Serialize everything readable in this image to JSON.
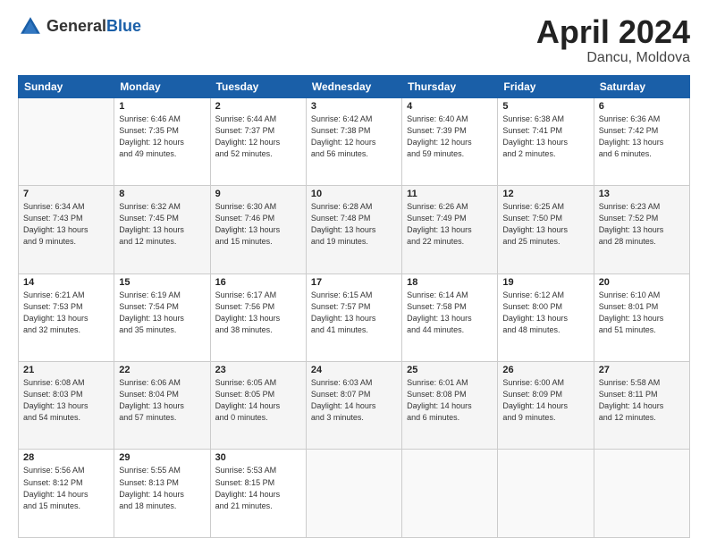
{
  "header": {
    "logo_line1": "General",
    "logo_line2": "Blue",
    "month_title": "April 2024",
    "location": "Dancu, Moldova"
  },
  "days_of_week": [
    "Sunday",
    "Monday",
    "Tuesday",
    "Wednesday",
    "Thursday",
    "Friday",
    "Saturday"
  ],
  "weeks": [
    [
      {
        "day": "",
        "info": ""
      },
      {
        "day": "1",
        "info": "Sunrise: 6:46 AM\nSunset: 7:35 PM\nDaylight: 12 hours\nand 49 minutes."
      },
      {
        "day": "2",
        "info": "Sunrise: 6:44 AM\nSunset: 7:37 PM\nDaylight: 12 hours\nand 52 minutes."
      },
      {
        "day": "3",
        "info": "Sunrise: 6:42 AM\nSunset: 7:38 PM\nDaylight: 12 hours\nand 56 minutes."
      },
      {
        "day": "4",
        "info": "Sunrise: 6:40 AM\nSunset: 7:39 PM\nDaylight: 12 hours\nand 59 minutes."
      },
      {
        "day": "5",
        "info": "Sunrise: 6:38 AM\nSunset: 7:41 PM\nDaylight: 13 hours\nand 2 minutes."
      },
      {
        "day": "6",
        "info": "Sunrise: 6:36 AM\nSunset: 7:42 PM\nDaylight: 13 hours\nand 6 minutes."
      }
    ],
    [
      {
        "day": "7",
        "info": "Sunrise: 6:34 AM\nSunset: 7:43 PM\nDaylight: 13 hours\nand 9 minutes."
      },
      {
        "day": "8",
        "info": "Sunrise: 6:32 AM\nSunset: 7:45 PM\nDaylight: 13 hours\nand 12 minutes."
      },
      {
        "day": "9",
        "info": "Sunrise: 6:30 AM\nSunset: 7:46 PM\nDaylight: 13 hours\nand 15 minutes."
      },
      {
        "day": "10",
        "info": "Sunrise: 6:28 AM\nSunset: 7:48 PM\nDaylight: 13 hours\nand 19 minutes."
      },
      {
        "day": "11",
        "info": "Sunrise: 6:26 AM\nSunset: 7:49 PM\nDaylight: 13 hours\nand 22 minutes."
      },
      {
        "day": "12",
        "info": "Sunrise: 6:25 AM\nSunset: 7:50 PM\nDaylight: 13 hours\nand 25 minutes."
      },
      {
        "day": "13",
        "info": "Sunrise: 6:23 AM\nSunset: 7:52 PM\nDaylight: 13 hours\nand 28 minutes."
      }
    ],
    [
      {
        "day": "14",
        "info": "Sunrise: 6:21 AM\nSunset: 7:53 PM\nDaylight: 13 hours\nand 32 minutes."
      },
      {
        "day": "15",
        "info": "Sunrise: 6:19 AM\nSunset: 7:54 PM\nDaylight: 13 hours\nand 35 minutes."
      },
      {
        "day": "16",
        "info": "Sunrise: 6:17 AM\nSunset: 7:56 PM\nDaylight: 13 hours\nand 38 minutes."
      },
      {
        "day": "17",
        "info": "Sunrise: 6:15 AM\nSunset: 7:57 PM\nDaylight: 13 hours\nand 41 minutes."
      },
      {
        "day": "18",
        "info": "Sunrise: 6:14 AM\nSunset: 7:58 PM\nDaylight: 13 hours\nand 44 minutes."
      },
      {
        "day": "19",
        "info": "Sunrise: 6:12 AM\nSunset: 8:00 PM\nDaylight: 13 hours\nand 48 minutes."
      },
      {
        "day": "20",
        "info": "Sunrise: 6:10 AM\nSunset: 8:01 PM\nDaylight: 13 hours\nand 51 minutes."
      }
    ],
    [
      {
        "day": "21",
        "info": "Sunrise: 6:08 AM\nSunset: 8:03 PM\nDaylight: 13 hours\nand 54 minutes."
      },
      {
        "day": "22",
        "info": "Sunrise: 6:06 AM\nSunset: 8:04 PM\nDaylight: 13 hours\nand 57 minutes."
      },
      {
        "day": "23",
        "info": "Sunrise: 6:05 AM\nSunset: 8:05 PM\nDaylight: 14 hours\nand 0 minutes."
      },
      {
        "day": "24",
        "info": "Sunrise: 6:03 AM\nSunset: 8:07 PM\nDaylight: 14 hours\nand 3 minutes."
      },
      {
        "day": "25",
        "info": "Sunrise: 6:01 AM\nSunset: 8:08 PM\nDaylight: 14 hours\nand 6 minutes."
      },
      {
        "day": "26",
        "info": "Sunrise: 6:00 AM\nSunset: 8:09 PM\nDaylight: 14 hours\nand 9 minutes."
      },
      {
        "day": "27",
        "info": "Sunrise: 5:58 AM\nSunset: 8:11 PM\nDaylight: 14 hours\nand 12 minutes."
      }
    ],
    [
      {
        "day": "28",
        "info": "Sunrise: 5:56 AM\nSunset: 8:12 PM\nDaylight: 14 hours\nand 15 minutes."
      },
      {
        "day": "29",
        "info": "Sunrise: 5:55 AM\nSunset: 8:13 PM\nDaylight: 14 hours\nand 18 minutes."
      },
      {
        "day": "30",
        "info": "Sunrise: 5:53 AM\nSunset: 8:15 PM\nDaylight: 14 hours\nand 21 minutes."
      },
      {
        "day": "",
        "info": ""
      },
      {
        "day": "",
        "info": ""
      },
      {
        "day": "",
        "info": ""
      },
      {
        "day": "",
        "info": ""
      }
    ]
  ]
}
